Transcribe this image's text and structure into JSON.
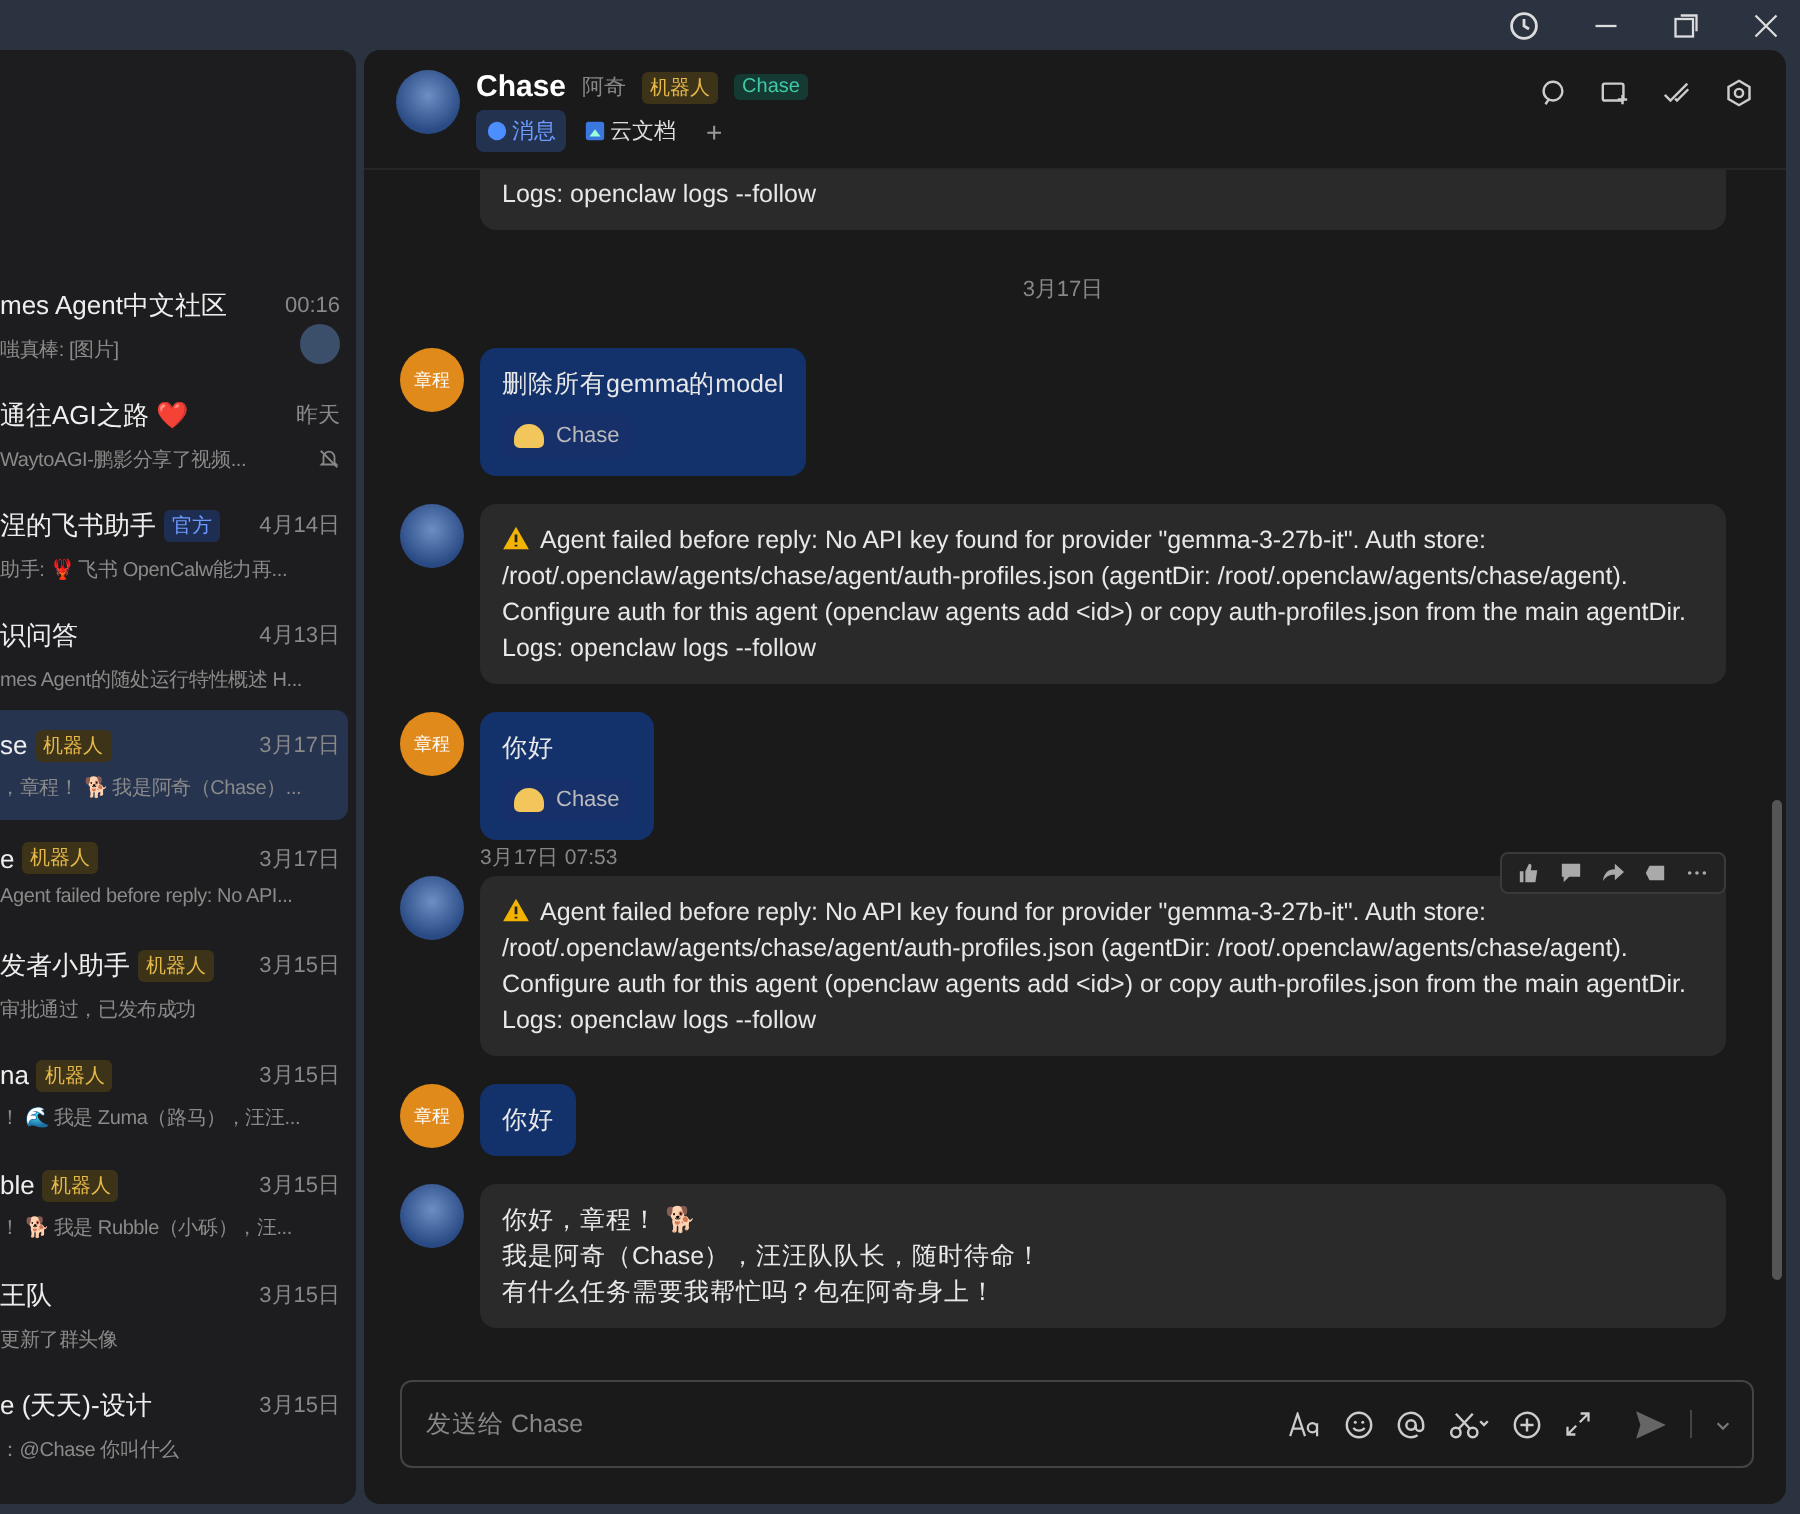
{
  "sidebar": {
    "items": [
      {
        "title": "mes Agent中文社区",
        "time": "00:16",
        "preview": "嗤真棒: [图片]",
        "has_avatar": true,
        "selected": false
      },
      {
        "title": "通往AGI之路 ❤️",
        "time": "昨天",
        "preview": "WaytoAGI-鹏影分享了视频...",
        "muted": true,
        "selected": false
      },
      {
        "title": "涅的飞书助手",
        "badge": {
          "text": "官方",
          "kind": "official"
        },
        "time": "4月14日",
        "preview": "助手: 🦞 飞书 OpenCalw能力再...",
        "selected": false
      },
      {
        "title": "识问答",
        "time": "4月13日",
        "preview": "mes Agent的随处运行特性概述 H...",
        "selected": false
      },
      {
        "title": "se",
        "badge": {
          "text": "机器人",
          "kind": "bot"
        },
        "time": "3月17日",
        "preview": "，章程！ 🐕 我是阿奇（Chase）...",
        "selected": true
      },
      {
        "title": "e",
        "badge": {
          "text": "机器人",
          "kind": "bot"
        },
        "time": "3月17日",
        "preview": "Agent failed before reply: No API...",
        "selected": false
      },
      {
        "title": "发者小助手",
        "badge": {
          "text": "机器人",
          "kind": "bot"
        },
        "time": "3月15日",
        "preview": "审批通过，已发布成功",
        "selected": false
      },
      {
        "title": "na",
        "badge": {
          "text": "机器人",
          "kind": "bot"
        },
        "time": "3月15日",
        "preview": "！ 🌊 我是 Zuma（路马），汪汪...",
        "selected": false
      },
      {
        "title": "ble",
        "badge": {
          "text": "机器人",
          "kind": "bot"
        },
        "time": "3月15日",
        "preview": "！ 🐕 我是 Rubble（小砾），汪...",
        "selected": false
      },
      {
        "title": "王队",
        "time": "3月15日",
        "preview": "更新了群头像",
        "selected": false
      },
      {
        "title": "e (天天)-设计",
        "time": "3月15日",
        "preview": "：@Chase 你叫什么",
        "selected": false
      }
    ]
  },
  "chat": {
    "name": "Chase",
    "alias": "阿奇",
    "tags": [
      {
        "text": "机器人",
        "kind": "bot"
      },
      {
        "text": "Chase",
        "kind": "name"
      }
    ],
    "tabs": [
      {
        "label": "消息",
        "selected": true
      },
      {
        "label": "云文档",
        "selected": false
      }
    ],
    "add_tab": "+"
  },
  "messages": [
    {
      "kind": "partial",
      "text": "Logs: openclaw logs --follow"
    },
    {
      "kind": "date",
      "text": "3月17日"
    },
    {
      "kind": "user",
      "avatar": "章程",
      "text": "删除所有gemma的model",
      "mention": "Chase"
    },
    {
      "kind": "bot",
      "warning": true,
      "lines": [
        "Agent failed before reply: No API key found for provider \"gemma-3-27b-it\". Auth store:",
        "/root/.openclaw/agents/chase/agent/auth-profiles.json (agentDir: /root/.openclaw/agents/chase/agent).",
        "Configure auth for this agent (openclaw agents add <id>) or copy auth-profiles.json from the main agentDir.",
        "Logs: openclaw logs --follow"
      ]
    },
    {
      "kind": "user",
      "avatar": "章程",
      "text": "你好",
      "mention": "Chase"
    },
    {
      "kind": "bot",
      "warning": true,
      "time": "3月17日 07:53",
      "toolbar": true,
      "lines": [
        "Agent failed before reply: No API key found for provider \"gemma-3-27b-it\". Auth store:",
        "/root/.openclaw/agents/chase/agent/auth-profiles.json (agentDir: /root/.openclaw/agents/chase/agent).",
        "Configure auth for this agent (openclaw agents add <id>) or copy auth-profiles.json from the main agentDir.",
        "Logs: openclaw logs --follow"
      ]
    },
    {
      "kind": "user",
      "avatar": "章程",
      "text": "你好"
    },
    {
      "kind": "bot",
      "warning": false,
      "lines": [
        "你好，章程！ 🐕",
        "我是阿奇（Chase），汪汪队队长，随时待命！",
        "有什么任务需要我帮忙吗？包在阿奇身上！"
      ]
    }
  ],
  "composer": {
    "placeholder": "发送给 Chase"
  }
}
